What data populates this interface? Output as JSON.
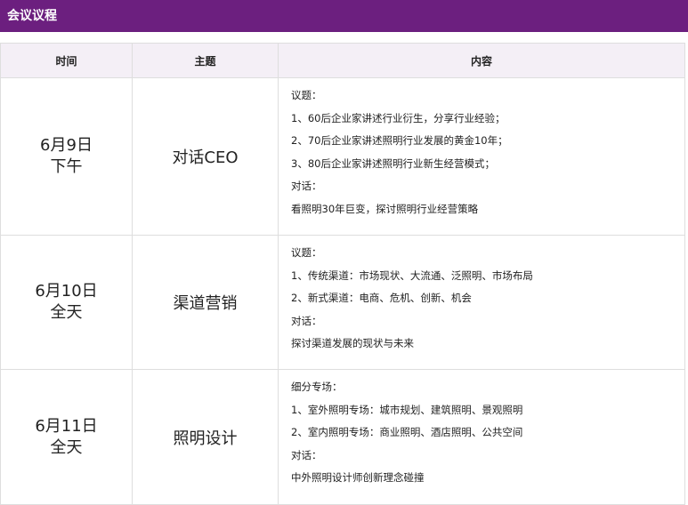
{
  "banner": {
    "title": "会议议程"
  },
  "table": {
    "headers": {
      "time": "时间",
      "topic": "主题",
      "content": "内容"
    },
    "rows": [
      {
        "date": "6月9日",
        "period": "下午",
        "topic": "对话CEO",
        "lines": [
          "议题：",
          "1、60后企业家讲述行业衍生，分享行业经验；",
          "2、70后企业家讲述照明行业发展的黄金10年；",
          "3、80后企业家讲述照明行业新生经营模式；",
          "对话：",
          "看照明30年巨变，探讨照明行业经营策略"
        ]
      },
      {
        "date": "6月10日",
        "period": "全天",
        "topic": "渠道营销",
        "lines": [
          "议题：",
          "1、传统渠道：市场现状、大流通、泛照明、市场布局",
          "2、新式渠道：电商、危机、创新、机会",
          "对话：",
          "探讨渠道发展的现状与未来"
        ]
      },
      {
        "date": "6月11日",
        "period": "全天",
        "topic": "照明设计",
        "lines": [
          "细分专场：",
          "1、室外照明专场：城市规划、建筑照明、景观照明",
          "2、室内照明专场：商业照明、酒店照明、公共空间",
          "对话：",
          "中外照明设计师创新理念碰撞"
        ]
      }
    ]
  }
}
